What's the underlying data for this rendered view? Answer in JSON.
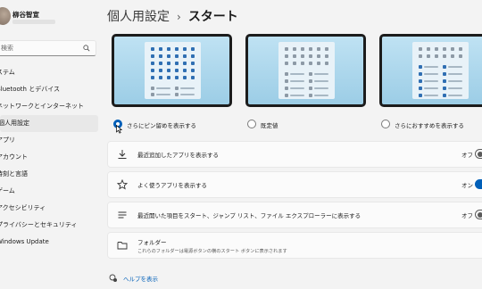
{
  "user": {
    "name": "柳谷智宣"
  },
  "search": {
    "placeholder": "検索"
  },
  "nav": [
    {
      "label": "ステム",
      "active": false
    },
    {
      "label": "Bluetooth とデバイス",
      "active": false
    },
    {
      "label": "ネットワークとインターネット",
      "active": false
    },
    {
      "label": "個人用設定",
      "active": true
    },
    {
      "label": "アプリ",
      "active": false
    },
    {
      "label": "アカウント",
      "active": false
    },
    {
      "label": "時刻と言語",
      "active": false
    },
    {
      "label": "ゲーム",
      "active": false
    },
    {
      "label": "アクセシビリティ",
      "active": false
    },
    {
      "label": "プライバシーとセキュリティ",
      "active": false
    },
    {
      "label": "Windows Update",
      "active": false
    }
  ],
  "header": {
    "parent": "個人用設定",
    "separator": "›",
    "current": "スタート"
  },
  "layouts": [
    {
      "label": "さらにピン留めを表示する",
      "selected": true
    },
    {
      "label": "既定値",
      "selected": false
    },
    {
      "label": "さらにおすすめを表示する",
      "selected": false
    }
  ],
  "settings": [
    {
      "label": "最近追加したアプリを表示する",
      "state": "オフ",
      "on": false,
      "icon": "download-icon"
    },
    {
      "label": "よく使うアプリを表示する",
      "state": "オン",
      "on": true,
      "icon": "star-icon"
    },
    {
      "label": "最近開いた項目をスタート、ジャンプ リスト、ファイル エクスプローラーに表示する",
      "state": "オフ",
      "on": false,
      "icon": "list-icon"
    }
  ],
  "folders": {
    "label": "フォルダー",
    "description": "これらのフォルダーは電源ボタンの横のスタート ボタンに表示されます",
    "icon": "folder-icon"
  },
  "help": {
    "label": "ヘルプを表示"
  },
  "colors": {
    "accent": "#005fb8",
    "tile_blue": "#2f6fb3",
    "tile_gray": "#8d9aa6",
    "background": "#f3f3f3"
  }
}
